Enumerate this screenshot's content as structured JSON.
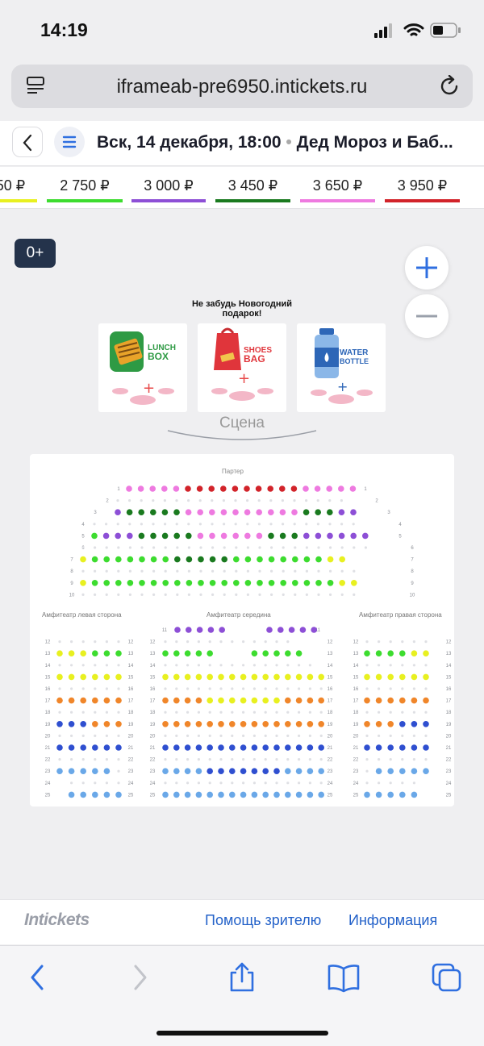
{
  "status_bar": {
    "time": "14:19"
  },
  "browser": {
    "url": "iframeab-pre6950.intickets.ru"
  },
  "event": {
    "title": "Вск, 14 декабря, 18:00",
    "separator": "•",
    "show": "Дед Мороз и Баб..."
  },
  "prices": [
    {
      "label": "50 ₽",
      "color": "#e8f020"
    },
    {
      "label": "2 750 ₽",
      "color": "#3ddc2f"
    },
    {
      "label": "3 000 ₽",
      "color": "#8d4fd6"
    },
    {
      "label": "3 450 ₽",
      "color": "#1a7a1f"
    },
    {
      "label": "3 650 ₽",
      "color": "#ee7ae0"
    },
    {
      "label": "3 950 ₽",
      "color": "#d2232a"
    }
  ],
  "map": {
    "age_rating": "0+",
    "promo_title_line1": "Не забудь Новогодний",
    "promo_title_line2": "подарок!",
    "promo_cards": [
      {
        "line1": "LUNCH",
        "line2": "BOX"
      },
      {
        "line1": "SHOES",
        "line2": "BAG"
      },
      {
        "line1": "WATER",
        "line2": "BOTTLE"
      }
    ],
    "stage_label": "Сцена",
    "sections": {
      "parterre": "Партер",
      "amph_left": "Амфитеатр левая сторона",
      "amph_middle": "Амфитеатр середина",
      "amph_right": "Амфитеатр правая сторона"
    },
    "parterre_rows": [
      "1",
      "2",
      "3",
      "4",
      "5",
      "6",
      "7",
      "8",
      "9",
      "10"
    ],
    "amph_rows": [
      "11",
      "12",
      "13",
      "14",
      "15",
      "16",
      "17",
      "18",
      "19",
      "20",
      "21",
      "22",
      "23",
      "24",
      "25"
    ]
  },
  "footer": {
    "logo": "Intickets",
    "links": [
      "Помощь зрителю",
      "Информация"
    ]
  },
  "colors": {
    "accent": "#2f6fe0",
    "seat_empty": "#dfe0e4",
    "orange": "#f0862a",
    "blue_dark": "#2f4fd0",
    "blue_light": "#6aa8e8"
  }
}
